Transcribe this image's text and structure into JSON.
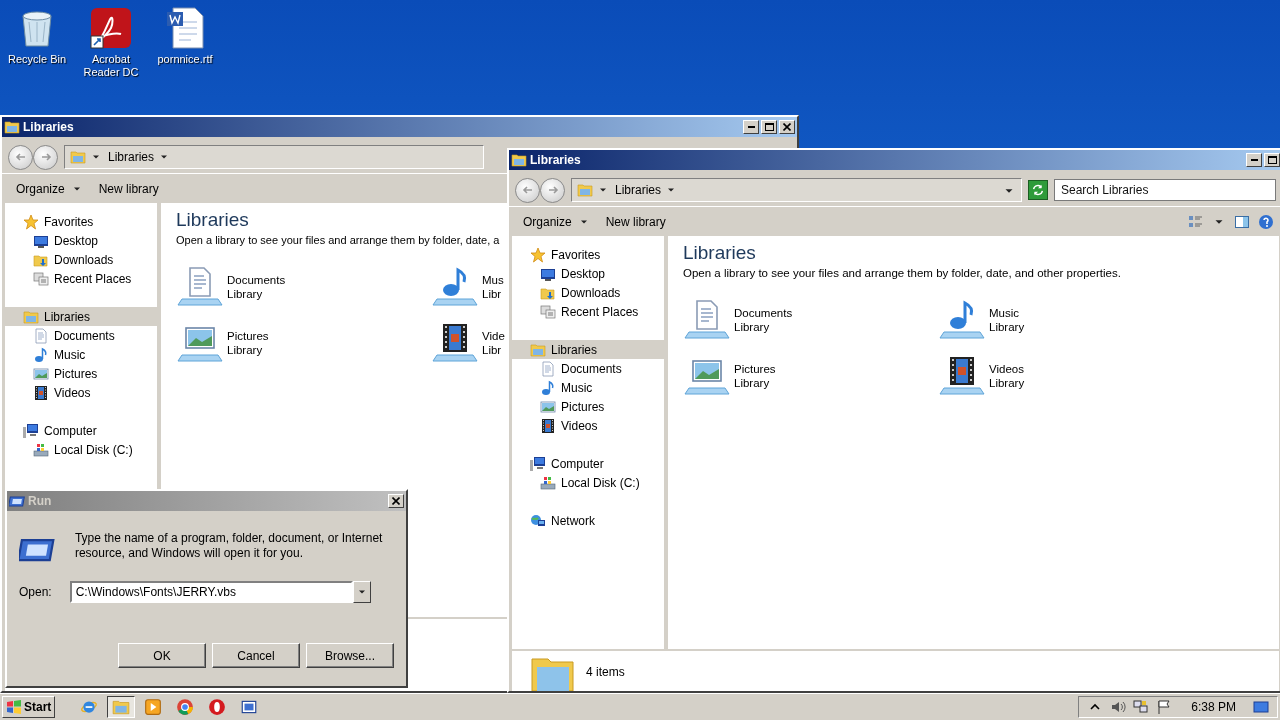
{
  "desktop_icons": [
    {
      "label": "Recycle Bin",
      "kind": "recycle"
    },
    {
      "label": "Acrobat Reader DC",
      "kind": "pdf"
    },
    {
      "label": "pornnice.rtf",
      "kind": "word"
    }
  ],
  "windows": [
    {
      "title": "Libraries",
      "breadcrumb": "Libraries",
      "toolbar": [
        {
          "label": "Organize",
          "dropdown": true
        },
        {
          "label": "New library",
          "dropdown": false
        }
      ],
      "nav": [
        {
          "label": "Favorites",
          "kind": "star",
          "selected": false,
          "children": [
            {
              "label": "Desktop",
              "kind": "desktop",
              "selected": false
            },
            {
              "label": "Downloads",
              "kind": "downloads",
              "selected": false
            },
            {
              "label": "Recent Places",
              "kind": "recent",
              "selected": false
            }
          ]
        },
        {
          "label": "Libraries",
          "kind": "libraries",
          "selected": true,
          "children": [
            {
              "label": "Documents",
              "kind": "documents",
              "selected": false
            },
            {
              "label": "Music",
              "kind": "music",
              "selected": false
            },
            {
              "label": "Pictures",
              "kind": "pictures",
              "selected": false
            },
            {
              "label": "Videos",
              "kind": "videos",
              "selected": false
            }
          ]
        },
        {
          "label": "Computer",
          "kind": "computer",
          "selected": false,
          "children": [
            {
              "label": "Local Disk (C:)",
              "kind": "disk",
              "selected": false
            }
          ]
        }
      ],
      "heading": "Libraries",
      "description": "Open a library to see your files and arrange them by folder, date, a",
      "libraries": [
        {
          "kind": "documents",
          "name": "Documents",
          "subtitle": "Library"
        },
        {
          "kind": "music",
          "name": "Mus",
          "subtitle": "Libr"
        },
        {
          "kind": "pictures",
          "name": "Pictures",
          "subtitle": "Library"
        },
        {
          "kind": "videos",
          "name": "Vide",
          "subtitle": "Libr"
        }
      ]
    },
    {
      "title": "Libraries",
      "breadcrumb": "Libraries",
      "search": {
        "placeholder": "Search Libraries"
      },
      "toolbar": [
        {
          "label": "Organize",
          "dropdown": true
        },
        {
          "label": "New library",
          "dropdown": false
        }
      ],
      "nav": [
        {
          "label": "Favorites",
          "kind": "star",
          "selected": false,
          "children": [
            {
              "label": "Desktop",
              "kind": "desktop",
              "selected": false
            },
            {
              "label": "Downloads",
              "kind": "downloads",
              "selected": false
            },
            {
              "label": "Recent Places",
              "kind": "recent",
              "selected": false
            }
          ]
        },
        {
          "label": "Libraries",
          "kind": "libraries",
          "selected": true,
          "children": [
            {
              "label": "Documents",
              "kind": "documents",
              "selected": false
            },
            {
              "label": "Music",
              "kind": "music",
              "selected": false
            },
            {
              "label": "Pictures",
              "kind": "pictures",
              "selected": false
            },
            {
              "label": "Videos",
              "kind": "videos",
              "selected": false
            }
          ]
        },
        {
          "label": "Computer",
          "kind": "computer",
          "selected": false,
          "children": [
            {
              "label": "Local Disk (C:)",
              "kind": "disk",
              "selected": false
            }
          ]
        },
        {
          "label": "Network",
          "kind": "network",
          "selected": false
        }
      ],
      "heading": "Libraries",
      "description": "Open a library to see your files and arrange them by folder, date, and other properties.",
      "libraries": [
        {
          "kind": "documents",
          "name": "Documents",
          "subtitle": "Library"
        },
        {
          "kind": "music",
          "name": "Music",
          "subtitle": "Library"
        },
        {
          "kind": "pictures",
          "name": "Pictures",
          "subtitle": "Library"
        },
        {
          "kind": "videos",
          "name": "Videos",
          "subtitle": "Library"
        }
      ],
      "status": "4 items"
    }
  ],
  "run_dialog": {
    "title": "Run",
    "message": "Type the name of a program, folder, document, or Internet resource, and Windows will open it for you.",
    "open_label": "Open:",
    "value": "C:\\Windows\\Fonts\\JERRY.vbs",
    "buttons": [
      "OK",
      "Cancel",
      "Browse..."
    ]
  },
  "taskbar": {
    "start": "Start",
    "items": [
      {
        "kind": "ie",
        "selected": false
      },
      {
        "kind": "explorer",
        "selected": true
      },
      {
        "kind": "media",
        "selected": false
      },
      {
        "kind": "chrome",
        "selected": false
      },
      {
        "kind": "opera",
        "selected": false
      },
      {
        "kind": "run",
        "selected": false
      }
    ],
    "clock": "6:38 PM"
  }
}
